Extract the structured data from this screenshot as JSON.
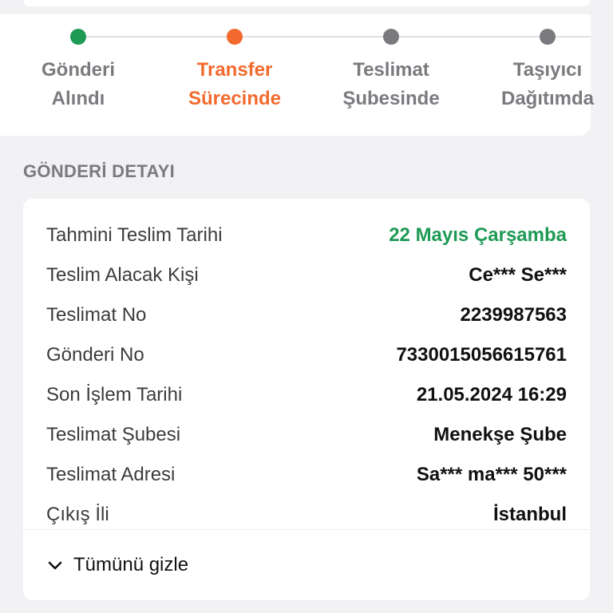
{
  "steps": [
    {
      "line1": "Gönderi",
      "line2": "Alındı",
      "color": "#1f9a55",
      "text_color": "#7a7a7f"
    },
    {
      "line1": "Transfer",
      "line2": "Sürecinde",
      "color": "#f26a2e",
      "text_color": "#f26a2e"
    },
    {
      "line1": "Teslimat",
      "line2": "Şubesinde",
      "color": "#7a7a7f",
      "text_color": "#7a7a7f"
    },
    {
      "line1": "Taşıyıcı",
      "line2": "Dağıtımda",
      "color": "#7a7a7f",
      "text_color": "#7a7a7f"
    }
  ],
  "section_title": "GÖNDERİ DETAYI",
  "details": [
    {
      "label": "Tahmini Teslim Tarihi",
      "value": "22 Mayıs Çarşamba",
      "highlight": true
    },
    {
      "label": "Teslim Alacak Kişi",
      "value": "Ce*** Se***"
    },
    {
      "label": "Teslimat No",
      "value": "2239987563"
    },
    {
      "label": "Gönderi No",
      "value": "7330015056615761"
    },
    {
      "label": "Son İşlem Tarihi",
      "value": "21.05.2024 16:29"
    },
    {
      "label": "Teslimat Şubesi",
      "value": "Menekşe Şube"
    },
    {
      "label": "Teslimat Adresi",
      "value": "Sa*** ma*** 50***"
    },
    {
      "label": "Çıkış İli",
      "value": "İstanbul"
    }
  ],
  "toggle": {
    "label": "Tümünü gizle",
    "icon": "chevron-down-icon"
  },
  "colors": {
    "accent_green": "#1f9a55",
    "accent_orange": "#f26a2e",
    "inactive": "#7a7a7f"
  }
}
